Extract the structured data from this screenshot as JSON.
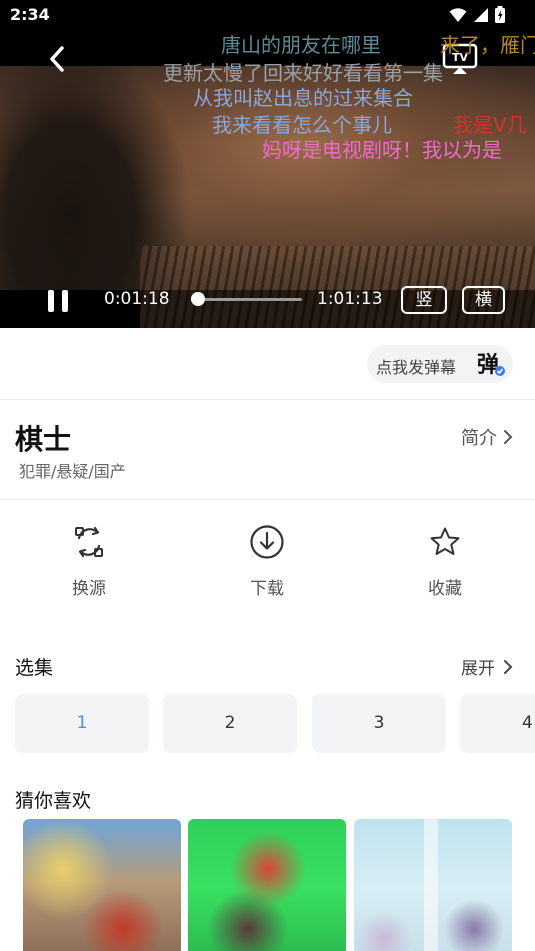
{
  "status_bar": {
    "time": "2:34"
  },
  "player": {
    "danmaku": [
      {
        "text": "唐山的朋友在哪里",
        "color": "#5f8a94"
      },
      {
        "text": "来了，雁门",
        "color": "#b8862a"
      },
      {
        "text": "更新太慢了回来好好看看第一集",
        "color": "#9aa0a6"
      },
      {
        "text": "从我叫赵出息的过来集合",
        "color": "#8aa7d8"
      },
      {
        "text": "我来看看怎么个事儿",
        "color": "#8aa7d8"
      },
      {
        "text": "我是V几",
        "color": "#d0342c"
      },
      {
        "text": "妈呀是电视剧呀！我以为是",
        "color": "#f06ad0"
      }
    ],
    "current_time": "0:01:18",
    "total_time": "1:01:13",
    "progress": 0.02,
    "portrait_label": "竖",
    "landscape_label": "横"
  },
  "danmaku_send": {
    "placeholder": "点我发弹幕",
    "icon_char": "弹"
  },
  "show": {
    "title": "棋士",
    "genres": "犯罪/悬疑/国产",
    "intro_label": "简介"
  },
  "actions": [
    {
      "label": "换源",
      "icon": "switch-source-icon"
    },
    {
      "label": "下载",
      "icon": "download-icon"
    },
    {
      "label": "收藏",
      "icon": "star-icon"
    }
  ],
  "episodes": {
    "title": "选集",
    "expand_label": "展开",
    "items": [
      "1",
      "2",
      "3",
      "4"
    ],
    "active_index": 0
  },
  "recommendations": {
    "title": "猜你喜欢"
  },
  "colors": {
    "accent": "#4a90d9",
    "chip_bg": "#f3f4f6"
  }
}
